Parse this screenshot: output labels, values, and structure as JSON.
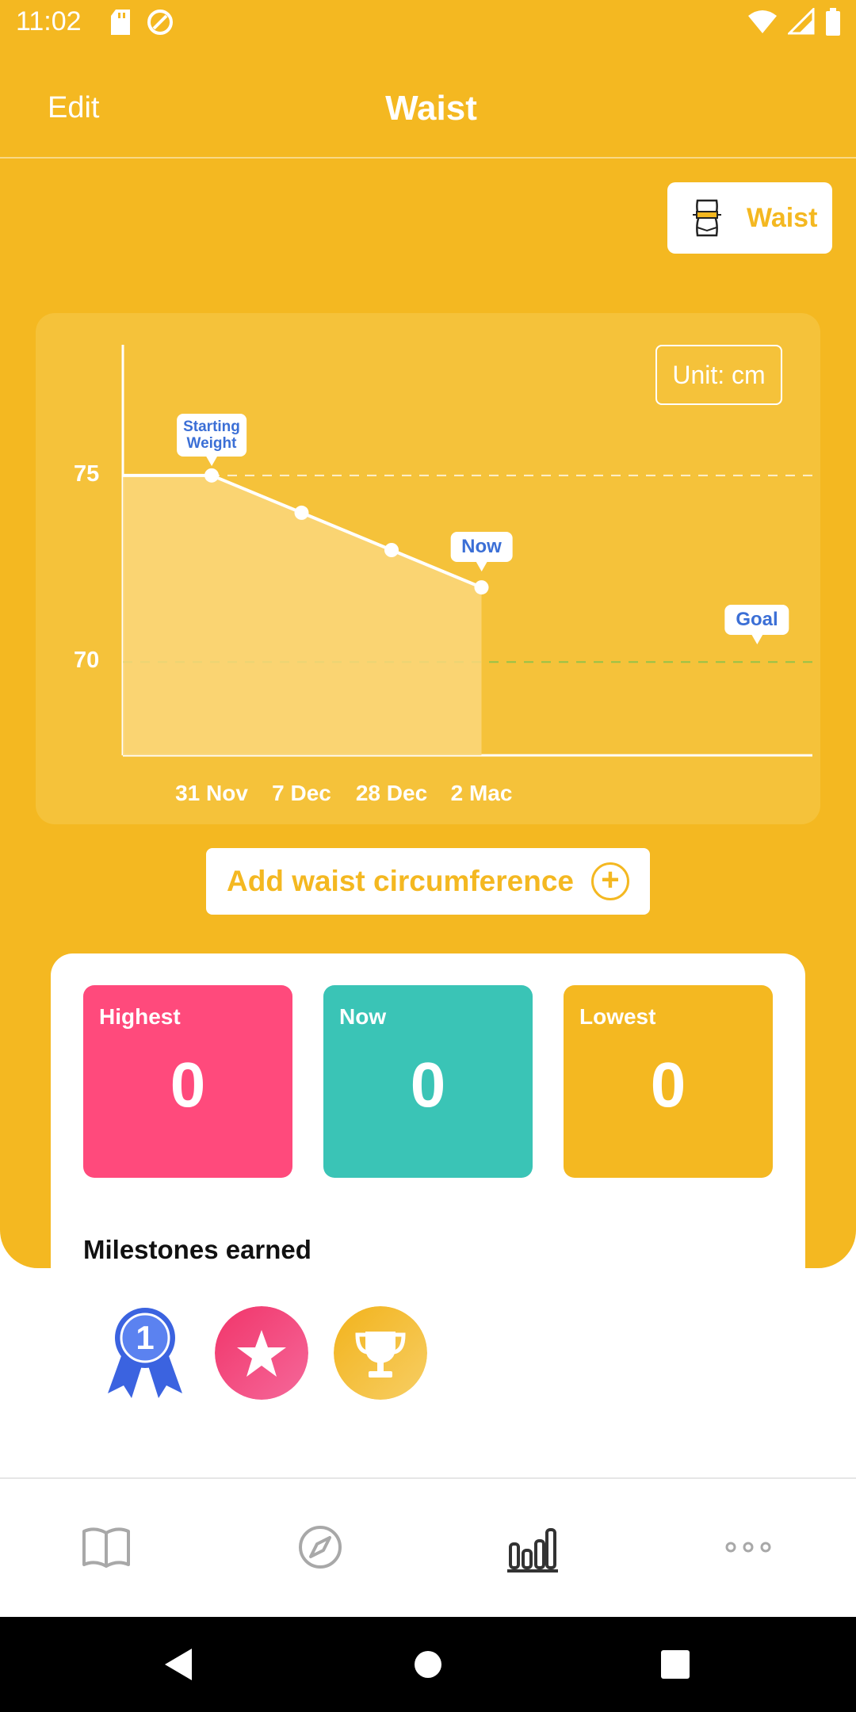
{
  "status_bar": {
    "time": "11:02"
  },
  "header": {
    "edit_label": "Edit",
    "title": "Waist"
  },
  "waist_chip": {
    "label": "Waist",
    "icon": "waist-figure-icon"
  },
  "chart": {
    "unit_label": "Unit: cm",
    "starting_callout": [
      "Starting",
      "Weight"
    ],
    "now_callout": "Now",
    "goal_callout": "Goal"
  },
  "chart_data": {
    "type": "area",
    "x_labels": [
      "31 Nov",
      "7 Dec",
      "28 Dec",
      "2 Mac"
    ],
    "values": [
      75,
      74,
      73,
      72
    ],
    "start_value": 75,
    "goal_value": 70,
    "y_ticks": [
      "75",
      "70"
    ],
    "ylim": [
      67.5,
      78.5
    ],
    "reference_lines": [
      {
        "value": 75,
        "color": "#FFFFFF",
        "style": "dashed"
      },
      {
        "value": 70,
        "color": "#8BC34A",
        "style": "dashed"
      }
    ],
    "grid": false,
    "colors": {
      "line": "#FFFFFF",
      "fill": "#FAD77D"
    }
  },
  "add_button": {
    "label": "Add waist circumference",
    "icon": "plus-circle-icon"
  },
  "stats": {
    "highest": {
      "label": "Highest",
      "value": "0",
      "color": "#FF4A7C"
    },
    "now": {
      "label": "Now",
      "value": "0",
      "color": "#3AC4B6"
    },
    "lowest": {
      "label": "Lowest",
      "value": "0",
      "color": "#F4B821"
    }
  },
  "milestones": {
    "title": "Milestones earned",
    "badges": [
      {
        "icon": "first-place-ribbon-icon",
        "number": "1",
        "color": "#3B63E0"
      },
      {
        "icon": "star-badge-icon",
        "color": "#F1356A"
      },
      {
        "icon": "trophy-badge-icon",
        "color": "#F4B821"
      }
    ]
  },
  "bottom_nav": {
    "items": [
      {
        "icon": "book-icon",
        "active": false
      },
      {
        "icon": "compass-icon",
        "active": false
      },
      {
        "icon": "bar-chart-icon",
        "active": true
      },
      {
        "icon": "more-dots-icon",
        "active": false
      }
    ]
  },
  "colors": {
    "brand": "#F4B821",
    "card": "#F5C23A",
    "accent_blue": "#3B6FD6"
  }
}
